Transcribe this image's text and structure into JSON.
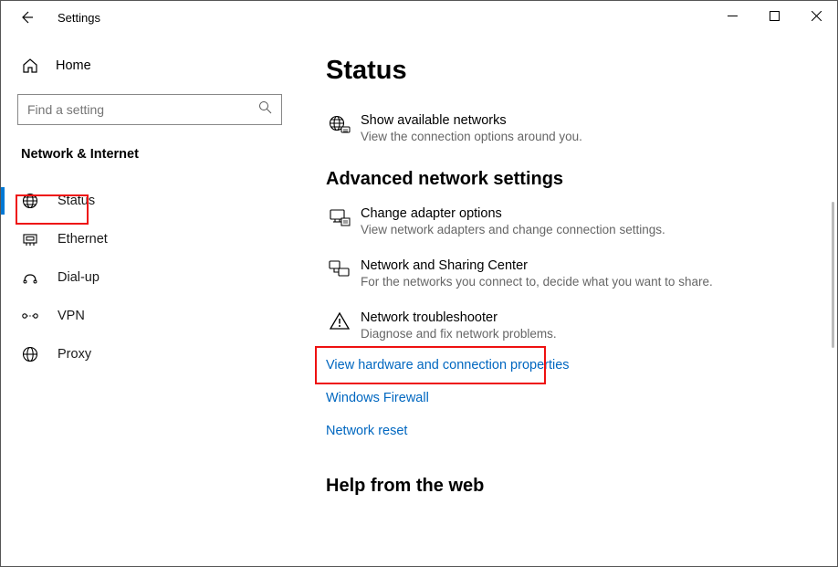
{
  "titlebar": {
    "title": "Settings"
  },
  "sidebar": {
    "home_label": "Home",
    "search_placeholder": "Find a setting",
    "category": "Network & Internet",
    "items": [
      {
        "label": "Status"
      },
      {
        "label": "Ethernet"
      },
      {
        "label": "Dial-up"
      },
      {
        "label": "VPN"
      },
      {
        "label": "Proxy"
      }
    ]
  },
  "main": {
    "heading": "Status",
    "available_networks": {
      "title": "Show available networks",
      "desc": "View the connection options around you."
    },
    "advanced_heading": "Advanced network settings",
    "adapter": {
      "title": "Change adapter options",
      "desc": "View network adapters and change connection settings."
    },
    "sharing": {
      "title": "Network and Sharing Center",
      "desc": "For the networks you connect to, decide what you want to share."
    },
    "troubleshoot": {
      "title": "Network troubleshooter",
      "desc": "Diagnose and fix network problems."
    },
    "links": {
      "hardware": "View hardware and connection properties",
      "firewall": "Windows Firewall",
      "reset": "Network reset"
    },
    "help_heading": "Help from the web"
  }
}
